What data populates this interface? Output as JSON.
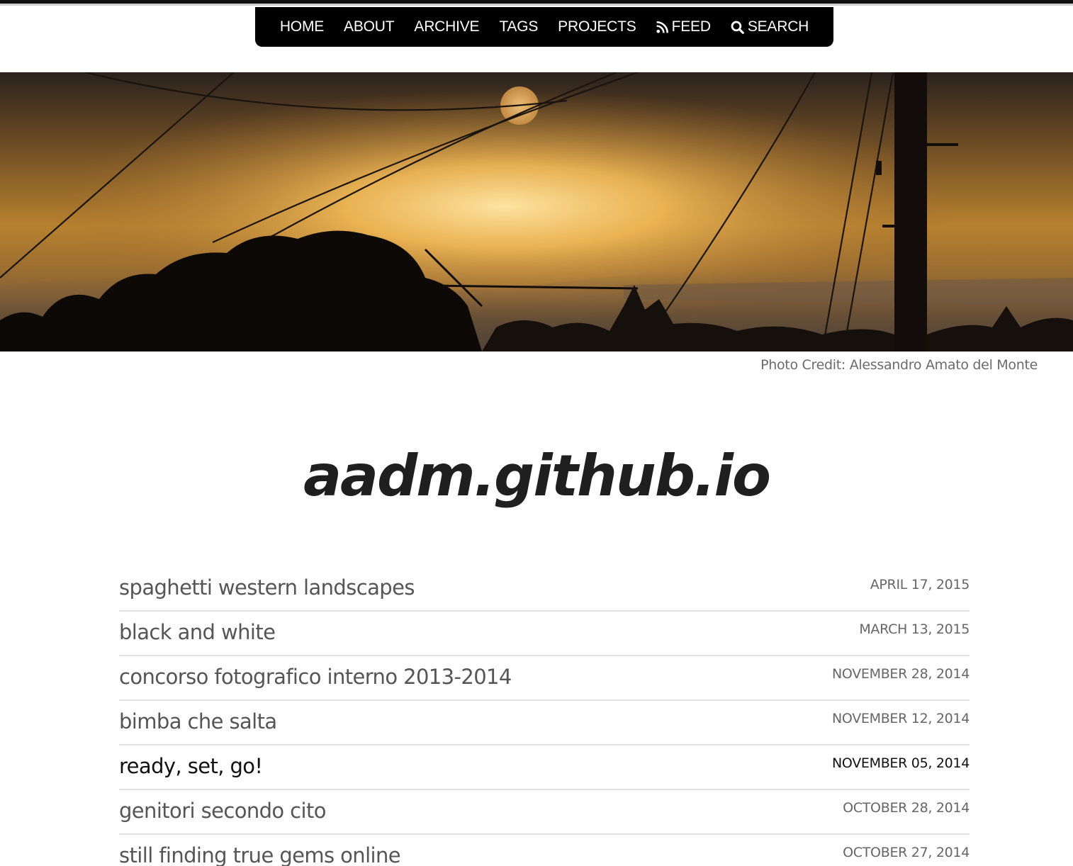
{
  "nav": {
    "items": [
      {
        "label": "HOME",
        "icon": ""
      },
      {
        "label": "ABOUT",
        "icon": ""
      },
      {
        "label": "ARCHIVE",
        "icon": ""
      },
      {
        "label": "TAGS",
        "icon": ""
      },
      {
        "label": "PROJECTS",
        "icon": ""
      },
      {
        "label": "FEED",
        "icon": "rss-icon"
      },
      {
        "label": "SEARCH",
        "icon": "search-icon"
      }
    ]
  },
  "hero": {
    "credit": "Photo Credit: Alessandro Amato del Monte"
  },
  "site": {
    "title": "aadm.github.io"
  },
  "posts": [
    {
      "title": "spaghetti western landscapes",
      "date": "APRIL 17, 2015"
    },
    {
      "title": "black and white",
      "date": "MARCH 13, 2015"
    },
    {
      "title": "concorso fotografico interno 2013-2014",
      "date": "NOVEMBER 28, 2014"
    },
    {
      "title": "bimba che salta",
      "date": "NOVEMBER 12, 2014"
    },
    {
      "title": "ready, set, go!",
      "date": "NOVEMBER 05, 2014"
    },
    {
      "title": "genitori secondo cito",
      "date": "OCTOBER 28, 2014"
    },
    {
      "title": "still finding true gems online",
      "date": "OCTOBER 27, 2014"
    }
  ],
  "colors": {
    "nav_background": "#000000",
    "text_muted": "#555555",
    "divider": "#e2e2e2"
  }
}
